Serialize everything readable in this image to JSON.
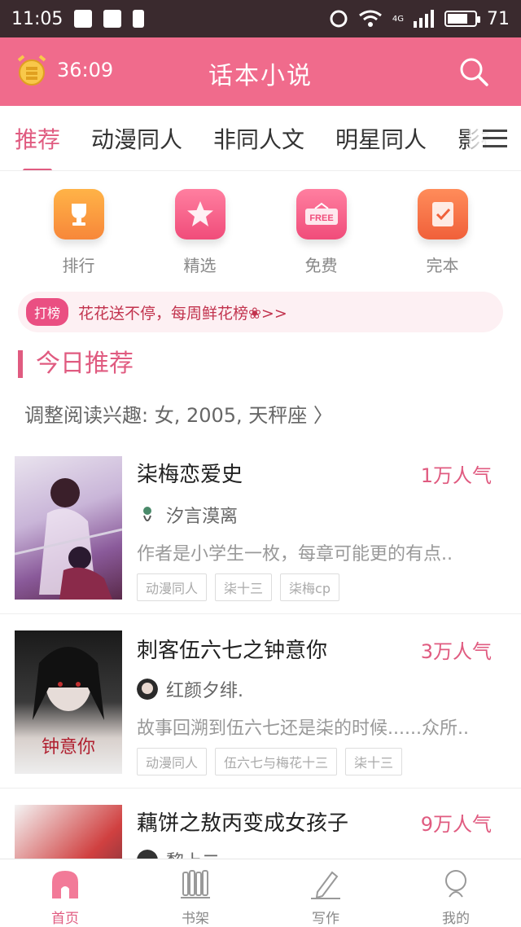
{
  "status_bar": {
    "time": "11:05",
    "battery": "71",
    "network": "4G"
  },
  "header": {
    "timer": "36:09",
    "title": "话本小说"
  },
  "tabs": [
    "推荐",
    "动漫同人",
    "非同人文",
    "明星同人",
    "影视"
  ],
  "quick_entries": [
    {
      "label": "排行",
      "icon": "trophy-icon"
    },
    {
      "label": "精选",
      "icon": "star-icon"
    },
    {
      "label": "免费",
      "icon": "free-sign-icon"
    },
    {
      "label": "完本",
      "icon": "check-book-icon"
    }
  ],
  "promo": {
    "tag": "打榜",
    "text": "花花送不停，每周鲜花榜❀>>"
  },
  "section": {
    "title": "今日推荐",
    "interest": "调整阅读兴趣: 女, 2005, 天秤座 〉"
  },
  "books": [
    {
      "title": "柒梅恋爱史",
      "popularity": "1万人气",
      "author": "汐言漠离",
      "description": "作者是小学生一枚，每章可能更的有点..",
      "tags": [
        "动漫同人",
        "柒十三",
        "柒梅cp"
      ]
    },
    {
      "title": "刺客伍六七之钟意你",
      "popularity": "3万人气",
      "author": "红颜夕绯.",
      "description": "故事回溯到伍六七还是柒的时候......众所..",
      "tags": [
        "动漫同人",
        "伍六七与梅花十三",
        "柒十三"
      ],
      "cover_text": "钟意你"
    },
    {
      "title": "藕饼之敖丙变成女孩子",
      "popularity": "9万人气",
      "author": "黎上二"
    }
  ],
  "bottom_nav": [
    {
      "label": "首页",
      "icon": "home-icon"
    },
    {
      "label": "书架",
      "icon": "bookshelf-icon"
    },
    {
      "label": "写作",
      "icon": "pen-icon"
    },
    {
      "label": "我的",
      "icon": "user-icon"
    }
  ],
  "colors": {
    "accent": "#e05b80",
    "header": "#f06b8c",
    "status_bar": "#3a2a2e"
  }
}
